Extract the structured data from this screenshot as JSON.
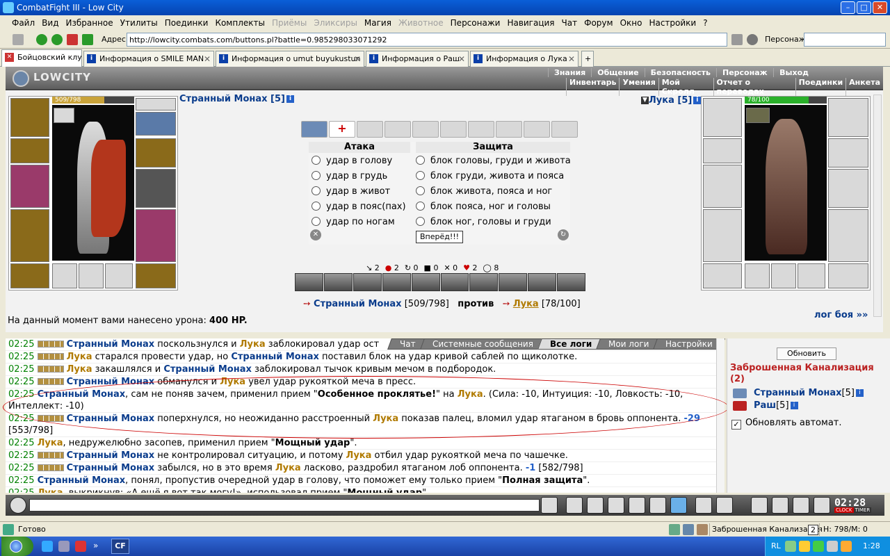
{
  "window": {
    "title": "CombatFight III - Low City"
  },
  "menu": [
    "Файл",
    "Вид",
    "Избранное",
    "Утилиты",
    "Поединки",
    "Комплекты",
    "Приёмы",
    "Эликсиры",
    "Магия",
    "Животное",
    "Персонажи",
    "Навигация",
    "Чат",
    "Форум",
    "Окно",
    "Настройки",
    "?"
  ],
  "menu_disabled": [
    "Приёмы",
    "Эликсиры",
    "Животное"
  ],
  "address": {
    "label": "Адрес:",
    "url": "http://lowcity.combats.com/buttons.pl?battle=0.985298033071292",
    "person_label": "Персонаж:"
  },
  "tabs": [
    {
      "label": "Бойцовский клуб",
      "active": true
    },
    {
      "label": "Информация о SMILE MAN"
    },
    {
      "label": "Информация о umut buyukustun"
    },
    {
      "label": "Информация о Раш"
    },
    {
      "label": "Информация о Лука"
    }
  ],
  "game": {
    "logo": "LOWCITY",
    "topnav": [
      "Знания",
      "Общение",
      "Безопасность",
      "Персонаж",
      "Выход"
    ],
    "subnav": [
      "Инвентарь",
      "Умения",
      "Мой Скролл",
      "Отчет о переводах",
      "Поединки",
      "Анкета"
    ],
    "player": {
      "name": "Странный Монах [5]",
      "hp_text": "509/798",
      "hp_fraction": 0.638
    },
    "opponent": {
      "name": "Лука [5]",
      "hp_text": "78/100",
      "hp_fraction": 0.78
    },
    "attack_header": "Атака",
    "defense_header": "Защита",
    "attacks": [
      "удар в голову",
      "удар в грудь",
      "удар в живот",
      "удар в пояс(пах)",
      "удар по ногам"
    ],
    "defenses": [
      "блок головы, груди и живота",
      "блок груди, живота и пояса",
      "блок живота, пояса и ног",
      "блок пояса, ног и головы",
      "блок ног, головы и груди"
    ],
    "go_button": "Вперёд!!!",
    "counters": [
      "2",
      "2",
      "0",
      "0",
      "0",
      "2",
      "8"
    ],
    "vs": {
      "p1": "Странный Монах",
      "p1_hp": "[509/798]",
      "word": "против",
      "p2": "Лука",
      "p2_hp": "[78/100]"
    },
    "damage": {
      "label": "На данный момент вами нанесено урона:",
      "value": "400 HP."
    },
    "log_link": "лог боя »»"
  },
  "chat_tabs": [
    "Чат",
    "Системные сообщения",
    "Все логи",
    "Мои логи",
    "Настройки"
  ],
  "chat_active_tab": "Все логи",
  "log": [
    {
      "t": "02:25",
      "sq": true,
      "parts": [
        [
          "b",
          "Странный Монах"
        ],
        [
          "n",
          " поскользнулся и "
        ],
        [
          "o",
          "Лука"
        ],
        [
          "n",
          " заблокировал удар ост"
        ]
      ]
    },
    {
      "t": "02:25",
      "sq": true,
      "parts": [
        [
          "o",
          "Лука"
        ],
        [
          "n",
          " старался провести удар, но "
        ],
        [
          "b",
          "Странный Монах"
        ],
        [
          "n",
          " поставил блок на удар кривой саблей по щиколотке."
        ]
      ]
    },
    {
      "t": "02:25",
      "sq": true,
      "parts": [
        [
          "o",
          "Лука"
        ],
        [
          "n",
          " закашлялся и "
        ],
        [
          "b",
          "Странный Монах"
        ],
        [
          "n",
          " заблокировал тычок кривым мечом в подбородок."
        ]
      ]
    },
    {
      "t": "02:25",
      "sq": true,
      "parts": [
        [
          "b",
          "Странный Монах"
        ],
        [
          "n",
          " обманулся и "
        ],
        [
          "o",
          "Лука"
        ],
        [
          "n",
          " увел удар рукояткой меча в пресс."
        ]
      ]
    },
    {
      "t": "02:25",
      "sq": false,
      "wrap": true,
      "parts": [
        [
          "b",
          "Странный Монах"
        ],
        [
          "n",
          ", сам не поняв зачем, применил прием \""
        ],
        [
          "bold",
          "Особенное проклятье!"
        ],
        [
          "n",
          "\" на "
        ],
        [
          "o",
          "Лука"
        ],
        [
          "n",
          ". (Сила: -10, Интуиция: -10, Ловкость: -10, Интеллект: -10)"
        ]
      ]
    },
    {
      "t": "02:25",
      "sq": true,
      "wrap": true,
      "parts": [
        [
          "b",
          "Странный Монах"
        ],
        [
          "n",
          " поперхнулся, но неожиданно расстроенный "
        ],
        [
          "o",
          "Лука"
        ],
        [
          "n",
          " показав палец, вломил удар ятаганом в бровь оппонента. "
        ],
        [
          "red",
          "-29"
        ],
        [
          "n",
          " [553/798]"
        ]
      ]
    },
    {
      "t": "02:25",
      "sq": false,
      "parts": [
        [
          "o",
          "Лука"
        ],
        [
          "n",
          ", недружелюбно засопев, применил прием \""
        ],
        [
          "bold",
          "Мощный удар"
        ],
        [
          "n",
          "\"."
        ]
      ]
    },
    {
      "t": "02:25",
      "sq": true,
      "parts": [
        [
          "b",
          "Странный Монах"
        ],
        [
          "n",
          " не контролировал ситуацию, и потому "
        ],
        [
          "o",
          "Лука"
        ],
        [
          "n",
          " отбил удар рукояткой меча по чашечке."
        ]
      ]
    },
    {
      "t": "02:25",
      "sq": true,
      "parts": [
        [
          "b",
          "Странный Монах"
        ],
        [
          "n",
          " забылся, но в это время "
        ],
        [
          "o",
          "Лука"
        ],
        [
          "n",
          " ласково, раздробил ятаганом лоб оппонента. "
        ],
        [
          "red",
          "-1"
        ],
        [
          "n",
          " [582/798]"
        ]
      ]
    },
    {
      "t": "02:25",
      "sq": false,
      "parts": [
        [
          "b",
          "Странный Монах"
        ],
        [
          "n",
          ", понял, пропустив очередной удар в голову, что поможет ему только прием \""
        ],
        [
          "bold",
          "Полная защита"
        ],
        [
          "n",
          "\"."
        ]
      ]
    },
    {
      "t": "02:25",
      "sq": false,
      "parts": [
        [
          "o",
          "Лука"
        ],
        [
          "n",
          ", выкрикнув: «А ещё я вот так могу!», использовал прием \""
        ],
        [
          "bold",
          "Мощный удар"
        ],
        [
          "n",
          "\"."
        ]
      ]
    }
  ],
  "right_panel": {
    "refresh": "Обновить",
    "location": "Заброшенная Канализация (2)",
    "users": [
      {
        "name": "Странный Монах",
        "level": "[5]"
      },
      {
        "name": "Раш",
        "level": "[5]"
      }
    ],
    "auto_refresh": "Обновлять автомат."
  },
  "clock": {
    "time": "02:28",
    "l1": "CLOCK",
    "l2": "TIMER"
  },
  "status": {
    "text": "Готово",
    "location": "Заброшенная Канализация",
    "count": "2",
    "hm": "Н: 798/М: 0"
  },
  "taskbar": {
    "app": "CF",
    "lang": "RL",
    "time": "1:28"
  },
  "colors": {
    "title_blue": "#0543b0",
    "name_blue": "#0a3c8c",
    "name_orange": "#b07a00",
    "timestamp_green": "#008000"
  }
}
